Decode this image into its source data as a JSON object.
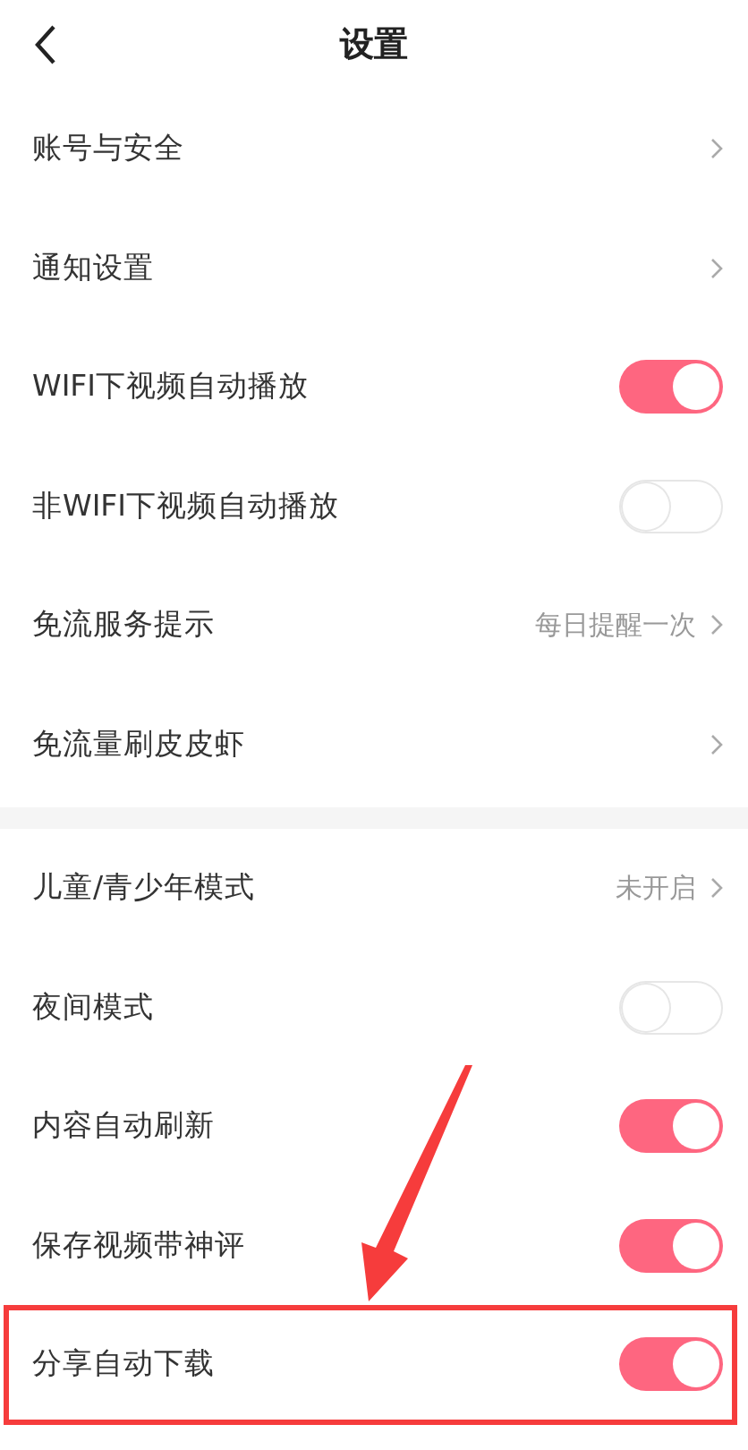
{
  "header": {
    "title": "设置"
  },
  "sections": [
    {
      "rows": [
        {
          "kind": "link",
          "label": "账号与安全",
          "highlighted": false
        },
        {
          "kind": "link",
          "label": "通知设置",
          "highlighted": false
        },
        {
          "kind": "toggle",
          "label": "WIFI下视频自动播放",
          "on": true,
          "highlighted": false
        },
        {
          "kind": "toggle",
          "label": "非WIFI下视频自动播放",
          "on": false,
          "highlighted": false
        },
        {
          "kind": "link",
          "label": "免流服务提示",
          "value": "每日提醒一次",
          "highlighted": false
        },
        {
          "kind": "link",
          "label": "免流量刷皮皮虾",
          "highlighted": false
        }
      ]
    },
    {
      "rows": [
        {
          "kind": "link",
          "label": "儿童/青少年模式",
          "value": "未开启",
          "highlighted": false
        },
        {
          "kind": "toggle",
          "label": "夜间模式",
          "on": false,
          "highlighted": false
        },
        {
          "kind": "toggle",
          "label": "内容自动刷新",
          "on": true,
          "highlighted": false
        },
        {
          "kind": "toggle",
          "label": "保存视频带神评",
          "on": true,
          "highlighted": false
        },
        {
          "kind": "toggle",
          "label": "分享自动下载",
          "on": true,
          "highlighted": true
        }
      ]
    }
  ]
}
